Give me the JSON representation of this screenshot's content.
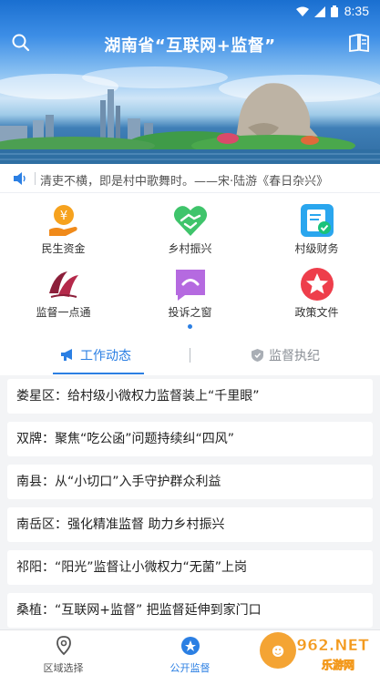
{
  "status_bar": {
    "time": "8:35"
  },
  "header": {
    "title": "湖南省“互联网+监督”"
  },
  "marquee": {
    "text": "清吏不横，即是村中歌舞时。——宋·陆游《春日杂兴》"
  },
  "grid": {
    "items": [
      {
        "label": "民生资金",
        "icon": "yuan-hand-icon"
      },
      {
        "label": "乡村振兴",
        "icon": "handshake-heart-icon"
      },
      {
        "label": "村级财务",
        "icon": "ledger-check-icon"
      },
      {
        "label": "监督一点通",
        "icon": "logo-icon"
      },
      {
        "label": "投诉之窗",
        "icon": "chat-icon"
      },
      {
        "label": "政策文件",
        "icon": "star-icon"
      }
    ]
  },
  "tabs": [
    {
      "label": "工作动态",
      "active": true
    },
    {
      "label": "监督执纪",
      "active": false
    }
  ],
  "news": [
    "娄星区：给村级小微权力监督装上“千里眼”",
    "双牌：聚焦“吃公函”问题持续纠“四风”",
    "南县：从“小切口”入手守护群众利益",
    "南岳区：强化精准监督 助力乡村振兴",
    "祁阳：“阳光”监督让小微权力“无菌”上岗",
    "桑植：“互联网+监督” 把监督延伸到家门口"
  ],
  "bottom_nav": [
    {
      "label": "区域选择",
      "active": false
    },
    {
      "label": "公开监督",
      "active": true
    },
    {
      "label": "",
      "active": false
    }
  ],
  "watermark": {
    "text": "962.NET",
    "subtext": "乐游网"
  },
  "colors": {
    "accent": "#2b7fe3",
    "text": "#222222",
    "muted": "#8a8f96"
  }
}
